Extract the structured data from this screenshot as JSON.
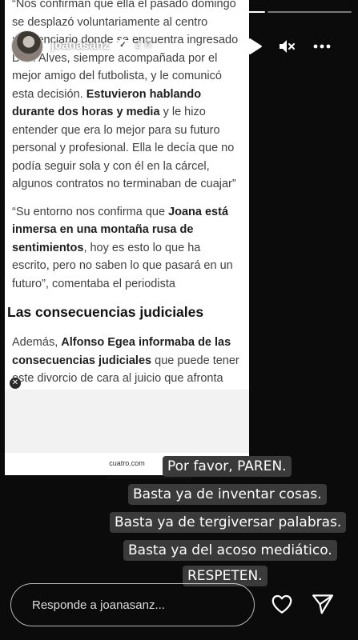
{
  "header": {
    "username": "joanasanz",
    "time": "2 h",
    "progress_segments": 4,
    "active_segment": 3
  },
  "article": {
    "paragraph_top": "“Nos confirman que ella el pasado domingo se desplazó voluntariamente al centro penitenciario donde se encuentra ingresado Dani Alves, siempre acompañada por el mejor amigo del futbolista, y le comunicó esta decisión.",
    "paragraph_top_bold": "Estuvieron hablando durante dos horas y media",
    "paragraph_top_end": "y le hizo entender que era lo mejor para su futuro personal y profesional. Ella le decía que no podía seguir sola y con él en la cárcel, algunos contratos no terminaban de cuajar”",
    "quote_start": "“Su entorno nos confirma que",
    "quote_bold": "Joana está inmersa en una montaña rusa de sentimientos",
    "quote_end": ", hoy es esto lo que ha escrito, pero no saben lo que pasará en un futuro”, comentaba el periodista",
    "heading": "Las consecuencias judiciales",
    "bottom_start": "Además,",
    "bottom_bold": "Alfonso Egea informaba de las consecuencias judiciales",
    "bottom_end": "que puede tener este divorcio de cara al juicio que afronta Dani Alves.",
    "source": "cuatro.com"
  },
  "overlay_text": [
    "Por favor, PAREN.",
    "Basta ya de inventar cosas.",
    "Basta ya de tergiversar palabras.",
    "Basta ya del acoso mediático.",
    "RESPETEN."
  ],
  "reply": {
    "placeholder": "Responde a joanasanz..."
  },
  "icons": {
    "play": "play-icon",
    "mute": "mute-icon",
    "more": "more-icon",
    "like": "heart-icon",
    "share": "send-icon",
    "verified": "verified-badge-icon",
    "ad_close": "close-icon"
  },
  "colors": {
    "overlay_bg": "#3a3a3a",
    "article_bg": "#ffffff"
  }
}
